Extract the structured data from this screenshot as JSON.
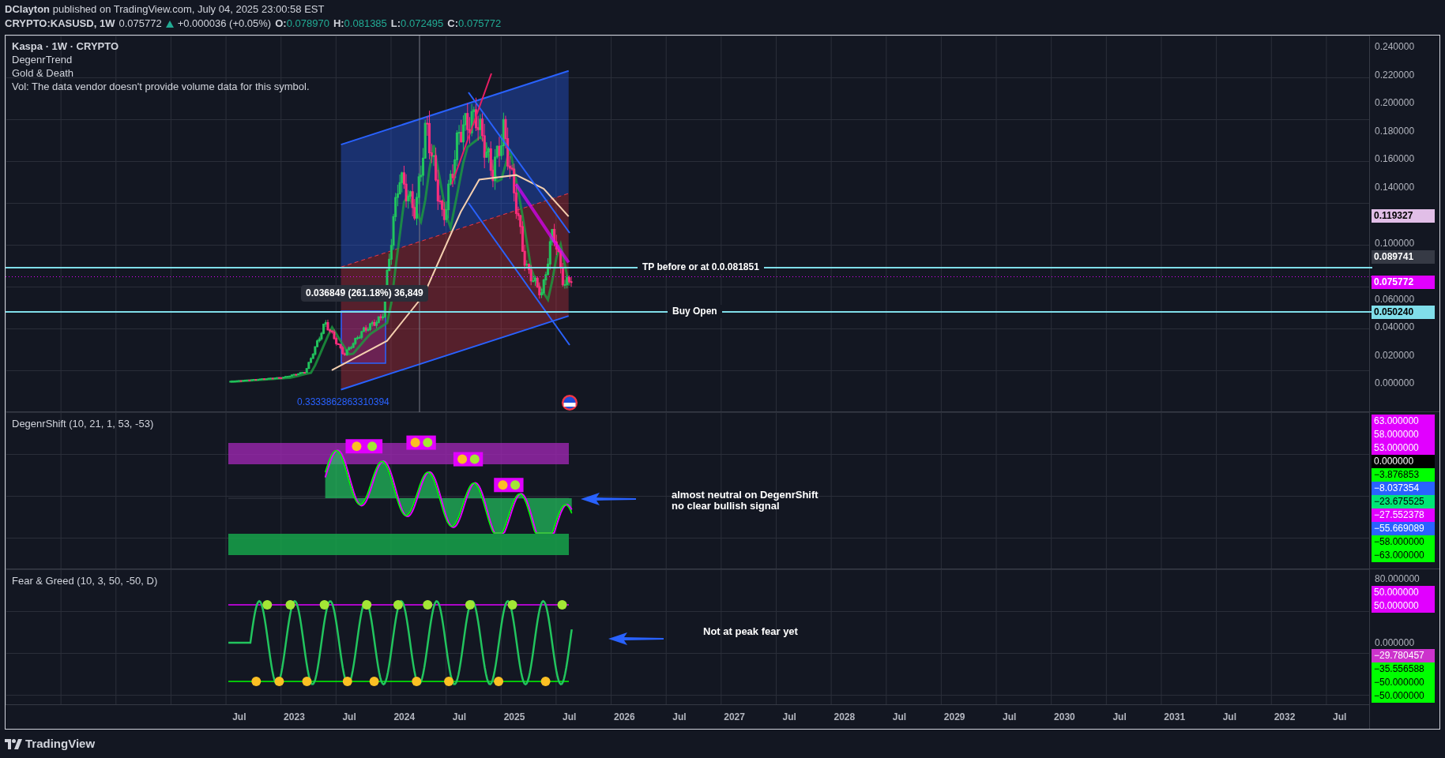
{
  "header": {
    "byline": "**DClayton** published on TradingView.com, July 04, 2025 23:00:58 EST"
  },
  "symbol_bar": {
    "symbol": "CRYPTO:KASUSD, 1W",
    "last": "0.075772",
    "change": "+0.000036 (+0.05%)",
    "ohlc": [
      {
        "label": "O:",
        "value": "0.078970"
      },
      {
        "label": "H:",
        "value": "0.081385"
      },
      {
        "label": "L:",
        "value": "0.072495"
      },
      {
        "label": "C:",
        "value": "0.075772"
      }
    ]
  },
  "main_pane": {
    "legend_title": "Kaspa · 1W · CRYPTO",
    "legend_lines": [
      "DegenrTrend",
      "Gold & Death",
      "Vol: The data vendor doesn't provide volume data for this symbol."
    ],
    "take_profit_label": "TP before or at 0.0.081851",
    "buy_label": "Buy Open",
    "measure_tooltip": "0.036849 (261.18%) 36,849",
    "fib_label": "0.3333862863310394",
    "axis_ticks": [
      "0.240000",
      "0.220000",
      "0.200000",
      "0.180000",
      "0.160000",
      "0.140000",
      "0.100000",
      "0.060000",
      "0.040000",
      "0.020000",
      "0.000000"
    ],
    "price_tags": [
      {
        "text": "0.119327",
        "color": "#e1bee7"
      },
      {
        "text": "0.089741",
        "color": "#363a45"
      },
      {
        "text": "0.075772",
        "color": "#e100ff"
      },
      {
        "text": "0.050240",
        "color": "#80deea"
      }
    ]
  },
  "shift_pane": {
    "legend": "DegenrShift (10, 21, 1, 53, -53)",
    "note_lines": [
      "almost neutral on DegenrShift",
      "no clear bullish signal"
    ],
    "tags": [
      {
        "text": "63.000000",
        "color": "#e100ff"
      },
      {
        "text": "58.000000",
        "color": "#e100ff"
      },
      {
        "text": "53.000000",
        "color": "#e100ff"
      },
      {
        "text": "0.000000",
        "color": "#000000"
      },
      {
        "text": "−3.876853",
        "color": "#00ff00"
      },
      {
        "text": "−8.037354",
        "color": "#2962ff"
      },
      {
        "text": "−23.675525",
        "color": "#00e676"
      },
      {
        "text": "−27.552378",
        "color": "#e100ff"
      },
      {
        "text": "−55.669089",
        "color": "#2962ff"
      },
      {
        "text": "−58.000000",
        "color": "#00ff00"
      },
      {
        "text": "−63.000000",
        "color": "#00ff00"
      }
    ]
  },
  "fear_greed_pane": {
    "legend": "Fear & Greed (10, 3, 50, -50, D)",
    "note": "Not at peak fear yet",
    "axis_ticks": [
      "80.000000",
      "0.000000"
    ],
    "upper_tags": [
      {
        "text": "50.000000",
        "color": "#e100ff"
      },
      {
        "text": "50.000000",
        "color": "#e100ff"
      }
    ],
    "lower_tags": [
      {
        "text": "−29.780457",
        "color": "#cc33cc"
      },
      {
        "text": "−35.556588",
        "color": "#00ff00"
      },
      {
        "text": "−50.000000",
        "color": "#00ff00"
      },
      {
        "text": "−50.000000",
        "color": "#00ff00"
      }
    ]
  },
  "time_axis": [
    "Jul",
    "2023",
    "Jul",
    "2024",
    "Jul",
    "2025",
    "Jul",
    "2026",
    "Jul",
    "2027",
    "Jul",
    "2028",
    "Jul",
    "2029",
    "Jul",
    "2030",
    "Jul",
    "2031",
    "Jul",
    "2032",
    "Jul"
  ],
  "footer": {
    "brand": "TradingView"
  }
}
